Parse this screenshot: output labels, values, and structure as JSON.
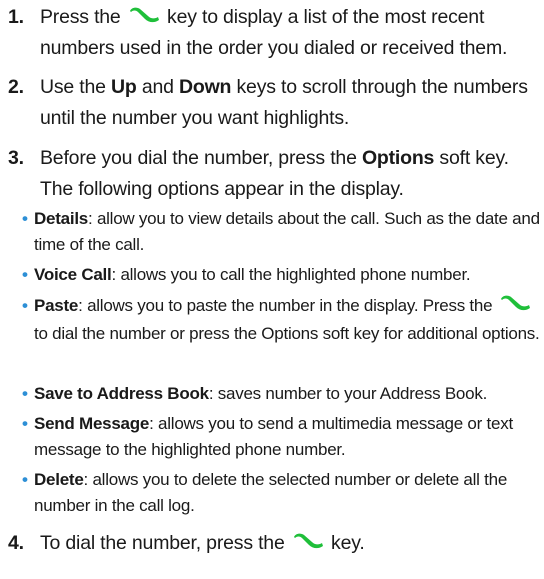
{
  "steps": [
    {
      "number": "1.",
      "text_before_icon": "Press the ",
      "icon": "send-key-icon",
      "text_after_icon": " key to display a list of the most recent numbers used in the order you dialed or received them."
    },
    {
      "number": "2.",
      "text_a": "Use the ",
      "bold_a": "Up",
      "text_b": " and ",
      "bold_b": "Down",
      "text_c": " keys to scroll through the numbers until the number you want highlights."
    },
    {
      "number": "3.",
      "text_a": "Before you dial the number, press the ",
      "bold_a": "Options",
      "text_b": " soft key. The following options appear in the display."
    },
    {
      "number": "4.",
      "text_before_icon": "To dial the number, press the ",
      "icon": "send-key-icon",
      "text_after_icon": " key."
    }
  ],
  "options": [
    {
      "term": "Details",
      "desc": ": allow you to view details about the call. Such as the date and time of the call."
    },
    {
      "term": "Voice Call",
      "desc": ": allows you to call the highlighted phone number."
    },
    {
      "term": "Paste",
      "desc_before_icon": ": allows you to paste the number in the display. Press the ",
      "icon": "send-key-icon",
      "desc_after_icon": " to dial the number or press the Options soft key for additional options."
    },
    {
      "term": "Save to Address Book",
      "desc": ": saves number to your Address Book."
    },
    {
      "term": "Send Message",
      "desc": ": allows you to send a multimedia message or text message to the highlighted phone number."
    },
    {
      "term": "Delete",
      "desc": ": allows you to delete the selected number or delete all the number in the call log."
    }
  ],
  "bullet_glyph": "•",
  "colors": {
    "bullet": "#2d8fd6",
    "send_key_icon": "#1fbf3a",
    "text": "#1a1a1a"
  }
}
